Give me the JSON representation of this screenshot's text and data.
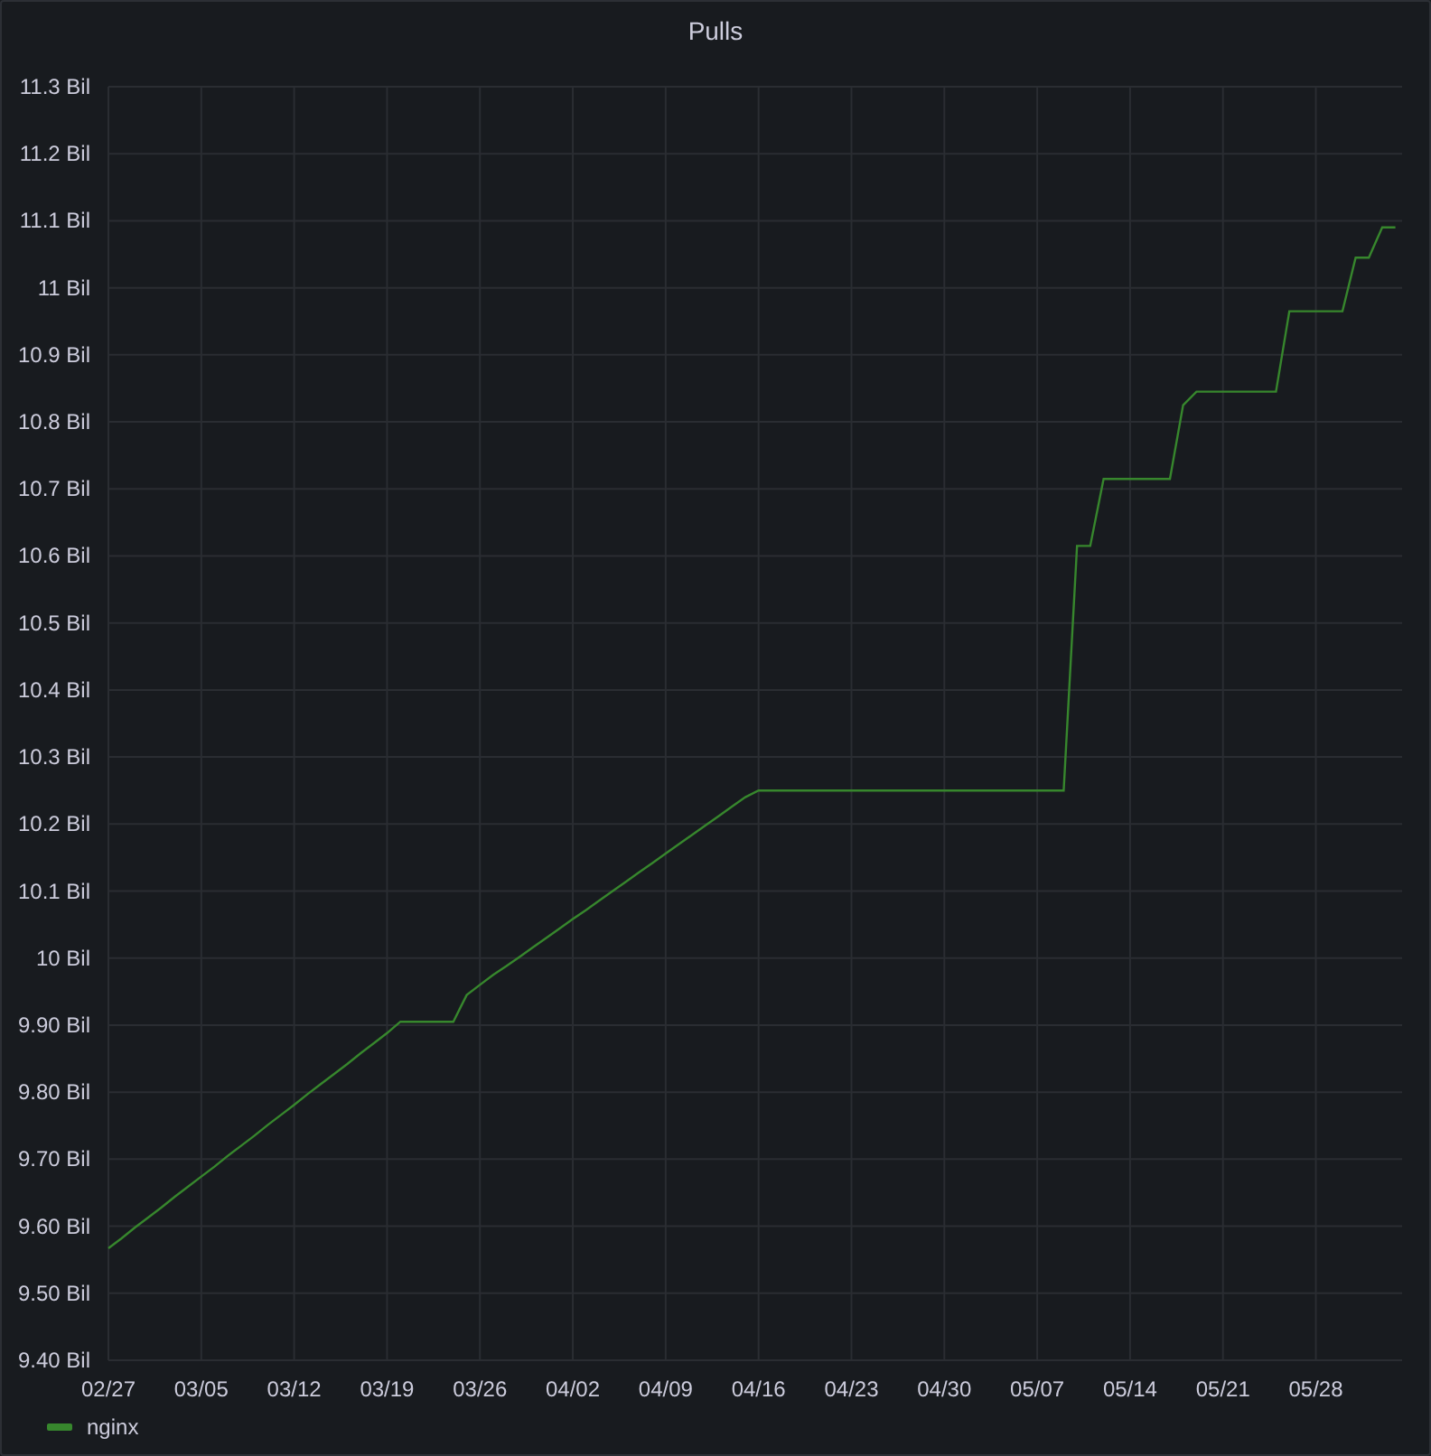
{
  "panel": {
    "title": "Pulls",
    "chart_data": {
      "type": "line",
      "grid": true,
      "ylim": [
        9.4,
        11.3
      ],
      "categories": [
        "02/27",
        null,
        null,
        null,
        null,
        null,
        null,
        "03/05",
        null,
        null,
        null,
        null,
        null,
        null,
        "03/12",
        null,
        null,
        null,
        null,
        null,
        null,
        "03/19",
        null,
        null,
        null,
        null,
        null,
        null,
        "03/26",
        null,
        null,
        null,
        null,
        null,
        null,
        "04/02",
        null,
        null,
        null,
        null,
        null,
        null,
        "04/09",
        null,
        null,
        null,
        null,
        null,
        null,
        "04/16",
        null,
        null,
        null,
        null,
        null,
        null,
        "04/23",
        null,
        null,
        null,
        null,
        null,
        null,
        "04/30",
        null,
        null,
        null,
        null,
        null,
        null,
        "05/07",
        null,
        null,
        null,
        null,
        null,
        null,
        "05/14",
        null,
        null,
        null,
        null,
        null,
        null,
        "05/21",
        null,
        null,
        null,
        null,
        null,
        null,
        "05/28",
        null,
        null,
        null,
        null,
        null,
        null
      ],
      "series": [
        {
          "name": "nginx",
          "color": "#37872d",
          "values": [
            9.567,
            9.582,
            9.598,
            9.613,
            9.628,
            9.644,
            9.659,
            9.674,
            9.689,
            9.705,
            9.72,
            9.735,
            9.751,
            9.766,
            9.781,
            9.797,
            9.812,
            9.827,
            9.842,
            9.858,
            9.873,
            9.888,
            9.905,
            9.905,
            9.905,
            9.905,
            9.905,
            9.945,
            9.96,
            9.975,
            9.988,
            10.002,
            10.016,
            10.03,
            10.044,
            10.058,
            10.072,
            10.086,
            10.1,
            10.114,
            10.128,
            10.142,
            10.156,
            10.17,
            10.184,
            10.198,
            10.212,
            10.226,
            10.24,
            10.25,
            10.25,
            10.25,
            10.25,
            10.25,
            10.25,
            10.25,
            10.25,
            10.25,
            10.25,
            10.25,
            10.25,
            10.25,
            10.25,
            10.25,
            10.25,
            10.25,
            10.25,
            10.25,
            10.25,
            10.25,
            10.25,
            10.25,
            10.25,
            10.615,
            10.615,
            10.715,
            10.715,
            10.715,
            10.715,
            10.715,
            10.715,
            10.825,
            10.845,
            10.845,
            10.845,
            10.845,
            10.845,
            10.845,
            10.845,
            10.965,
            10.965,
            10.965,
            10.965,
            10.965,
            11.045,
            11.045,
            11.09,
            11.09
          ]
        }
      ],
      "yticks": [
        {
          "value": 9.4,
          "label": "9.40 Bil"
        },
        {
          "value": 9.5,
          "label": "9.50 Bil"
        },
        {
          "value": 9.6,
          "label": "9.60 Bil"
        },
        {
          "value": 9.7,
          "label": "9.70 Bil"
        },
        {
          "value": 9.8,
          "label": "9.80 Bil"
        },
        {
          "value": 9.9,
          "label": "9.90 Bil"
        },
        {
          "value": 10,
          "label": "10 Bil"
        },
        {
          "value": 10.1,
          "label": "10.1 Bil"
        },
        {
          "value": 10.2,
          "label": "10.2 Bil"
        },
        {
          "value": 10.3,
          "label": "10.3 Bil"
        },
        {
          "value": 10.4,
          "label": "10.4 Bil"
        },
        {
          "value": 10.5,
          "label": "10.5 Bil"
        },
        {
          "value": 10.6,
          "label": "10.6 Bil"
        },
        {
          "value": 10.7,
          "label": "10.7 Bil"
        },
        {
          "value": 10.8,
          "label": "10.8 Bil"
        },
        {
          "value": 10.9,
          "label": "10.9 Bil"
        },
        {
          "value": 11,
          "label": "11 Bil"
        },
        {
          "value": 11.1,
          "label": "11.1 Bil"
        },
        {
          "value": 11.2,
          "label": "11.2 Bil"
        },
        {
          "value": 11.3,
          "label": "11.3 Bil"
        }
      ]
    }
  }
}
